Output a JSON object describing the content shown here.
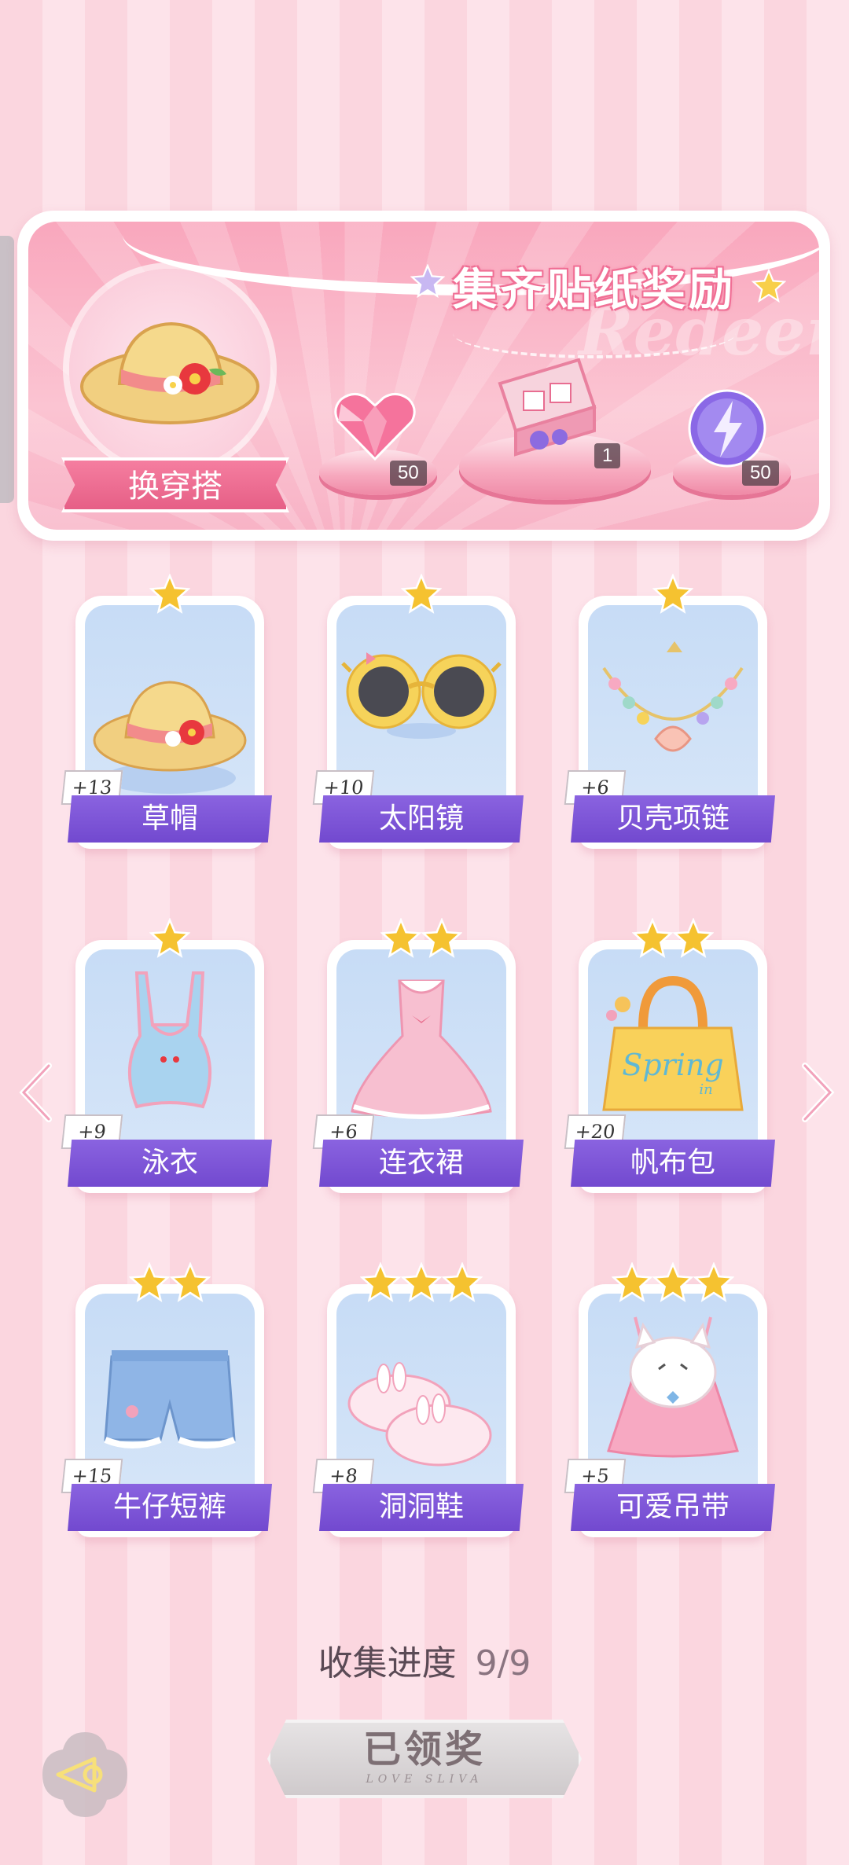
{
  "banner": {
    "title": "集齐贴纸奖励",
    "watermark": "Redeem",
    "outfit_button": "换穿搭",
    "rewards": [
      {
        "icon": "pink-heart-gem-icon",
        "count": "50"
      },
      {
        "icon": "gift-box-icon",
        "count": "1"
      },
      {
        "icon": "energy-orb-icon",
        "count": "50"
      }
    ]
  },
  "items": [
    {
      "name": "草帽",
      "bonus": "+13",
      "stars": 1,
      "icon": "straw-hat-icon"
    },
    {
      "name": "太阳镜",
      "bonus": "+10",
      "stars": 1,
      "icon": "sunglasses-icon"
    },
    {
      "name": "贝壳项链",
      "bonus": "+6",
      "stars": 1,
      "icon": "shell-necklace-icon"
    },
    {
      "name": "泳衣",
      "bonus": "+9",
      "stars": 1,
      "icon": "swimsuit-icon"
    },
    {
      "name": "连衣裙",
      "bonus": "+6",
      "stars": 2,
      "icon": "dress-icon"
    },
    {
      "name": "帆布包",
      "bonus": "+20",
      "stars": 2,
      "icon": "canvas-bag-icon"
    },
    {
      "name": "牛仔短裤",
      "bonus": "+15",
      "stars": 2,
      "icon": "denim-shorts-icon"
    },
    {
      "name": "洞洞鞋",
      "bonus": "+8",
      "stars": 3,
      "icon": "clogs-icon"
    },
    {
      "name": "可爱吊带",
      "bonus": "+5",
      "stars": 3,
      "icon": "cute-camisole-icon"
    }
  ],
  "bag_text": "Spring",
  "bag_subtext": "in",
  "progress": {
    "label": "收集进度",
    "value": "9/9"
  },
  "claim_button": {
    "label": "已领奖",
    "subtext": "LOVE SLIVA"
  },
  "colors": {
    "label_purple": "#7a52d6",
    "accent_pink": "#f06f95",
    "star_gold": "#f5c230"
  }
}
